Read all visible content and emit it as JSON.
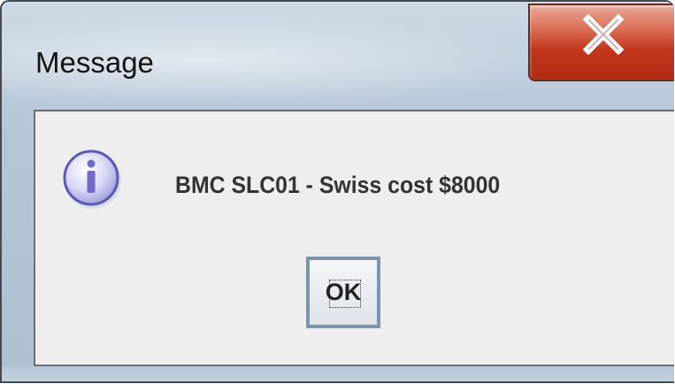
{
  "window": {
    "title": "Message"
  },
  "titlebar": {
    "close_icon": "close-icon"
  },
  "dialog": {
    "icon": "info-icon",
    "message": "BMC SLC01 - Swiss cost $8000",
    "ok_label": "OK"
  },
  "colors": {
    "close_button": "#c2361b",
    "content_bg": "#eeeeee",
    "titlebar_bg": "#c1cfdd",
    "ok_border": "#7c95ad",
    "info_icon": "#8a88d6"
  }
}
